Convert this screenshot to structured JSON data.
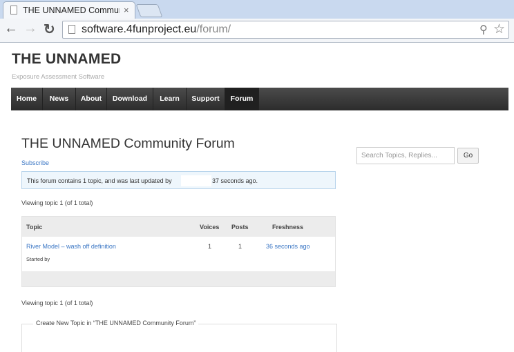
{
  "browser": {
    "tab_title": "THE UNNAMED Community Forum",
    "close_glyph": "×",
    "back_glyph": "←",
    "forward_glyph": "→",
    "reload_glyph": "↻",
    "url_host": "software.4funproject.eu",
    "url_path": "/forum/",
    "zoom_glyph": "⚲",
    "star_glyph": "☆"
  },
  "site": {
    "title": "THE UNNAMED",
    "description": "Exposure Assessment Software"
  },
  "nav": {
    "items": [
      {
        "label": "Home"
      },
      {
        "label": "News"
      },
      {
        "label": "About"
      },
      {
        "label": "Download"
      },
      {
        "label": "Learn"
      },
      {
        "label": "Support"
      },
      {
        "label": "Forum",
        "current": true
      }
    ]
  },
  "forum": {
    "title": "THE UNNAMED Community Forum",
    "subscribe": "Subscribe",
    "notice_prefix": "This forum contains 1 topic, and was last updated by",
    "notice_suffix": "37 seconds ago.",
    "viewing_top": "Viewing topic 1 (of 1 total)",
    "viewing_bottom": "Viewing topic 1 (of 1 total)",
    "columns": {
      "topic": "Topic",
      "voices": "Voices",
      "posts": "Posts",
      "freshness": "Freshness"
    },
    "topics": [
      {
        "title": "River Model – wash off definition",
        "started_by": "Started by",
        "voices": "1",
        "posts": "1",
        "freshness": "36 seconds ago"
      }
    ],
    "new_topic_legend": "Create New Topic in “THE UNNAMED Community Forum”"
  },
  "search": {
    "placeholder": "Search Topics, Replies...",
    "button": "Go"
  }
}
